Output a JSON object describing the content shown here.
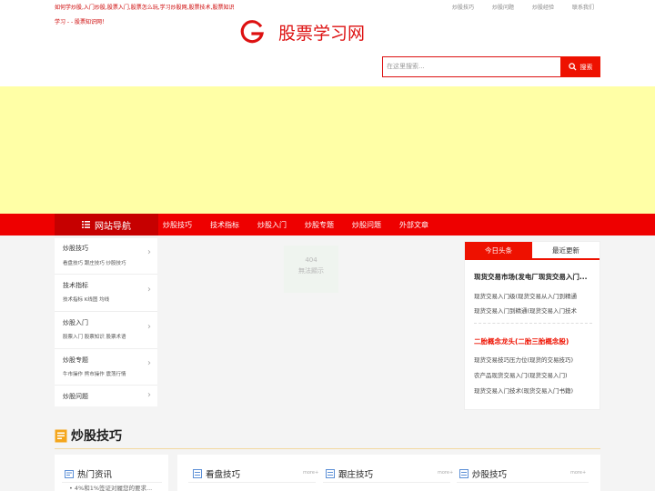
{
  "header": {
    "tagline": "如何学炒股,入门炒股,股票入门,股票怎么玩,学习炒股网,股票技术,股票知识",
    "tagline2": "学习 - - 股票知识网！",
    "top_links": [
      "炒股技巧",
      "炒股问题",
      "炒股经验",
      "联系我们"
    ],
    "logo_text": "股票学习网",
    "search_placeholder": "在这里搜索...",
    "search_button": "搜索"
  },
  "nav": {
    "home": "网站导航",
    "items": [
      "炒股技巧",
      "技术指标",
      "炒股入门",
      "炒股专题",
      "炒股问题",
      "外部文章"
    ]
  },
  "sidebar": {
    "items": [
      {
        "title": "炒股技巧",
        "sub": "看盘技巧 跟庄技巧 炒股技巧"
      },
      {
        "title": "技术指标",
        "sub": "技术指标 K线图 均线"
      },
      {
        "title": "炒股入门",
        "sub": "股票入门 股票知识 股票术语"
      },
      {
        "title": "炒股专题",
        "sub": "牛市操作 熊市操作 震荡行情"
      },
      {
        "title": "炒股问题",
        "sub": ""
      }
    ]
  },
  "placeholder": {
    "line1": "404",
    "line2": "無法顯示"
  },
  "panel": {
    "tabs": [
      "今日头条",
      "最近更新"
    ],
    "headline1": "现货交易市场(发电厂现货交易入门...",
    "items1": [
      "现货交易入门级(现货交易从入门到精通",
      "现货交易入门到精通(现货交易入门技术"
    ],
    "headline2": "二胎概念龙头(二胎三胎概念股)",
    "items2": [
      "现货交易技巧压力位(现货的交易技巧)",
      "农产品现货交易入门(现货交易入门)",
      "现货交易入门技术(现货交易入门书籍)"
    ]
  },
  "section": {
    "title": "炒股技巧",
    "hot_title": "热门资讯",
    "hot_item": "• 4%和1%签证对履您的要求...",
    "cards": [
      {
        "title": "看盘技巧",
        "more": "more+"
      },
      {
        "title": "跟庄技巧",
        "more": "more+"
      },
      {
        "title": "炒股技巧",
        "more": "more+"
      }
    ]
  },
  "colors": {
    "brand_red": "#ee0000",
    "ad_yellow": "#ffffa6"
  }
}
